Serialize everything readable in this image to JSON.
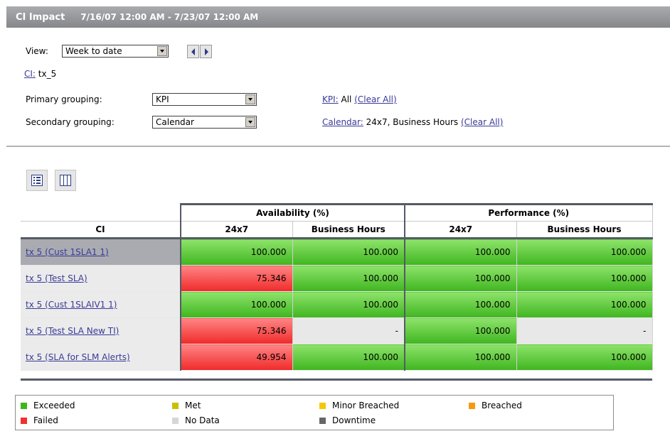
{
  "header": {
    "title": "CI Impact",
    "date_range": "7/16/07 12:00 AM - 7/23/07 12:00 AM"
  },
  "filters": {
    "view_label": "View:",
    "view_value": "Week to date",
    "ci_label": "CI:",
    "ci_value": "tx_5",
    "primary_label": "Primary grouping:",
    "primary_value": "KPI",
    "secondary_label": "Secondary grouping:",
    "secondary_value": "Calendar",
    "kpi_label": "KPI:",
    "kpi_value": "All",
    "kpi_clear": "(Clear All)",
    "calendar_label": "Calendar:",
    "calendar_value": "24x7, Business Hours",
    "calendar_clear": "(Clear All)"
  },
  "table": {
    "groups": [
      "Availability (%)",
      "Performance (%)"
    ],
    "columns": [
      "CI",
      "24x7",
      "Business Hours",
      "24x7",
      "Business Hours"
    ],
    "rows": [
      {
        "ci": "tx 5 (Cust 1SLA1 1)",
        "cells": [
          {
            "v": "100.000",
            "status": "green"
          },
          {
            "v": "100.000",
            "status": "green"
          },
          {
            "v": "100.000",
            "status": "green"
          },
          {
            "v": "100.000",
            "status": "green"
          }
        ]
      },
      {
        "ci": "tx 5 (Test SLA)",
        "cells": [
          {
            "v": "75.346",
            "status": "red"
          },
          {
            "v": "100.000",
            "status": "green"
          },
          {
            "v": "100.000",
            "status": "green"
          },
          {
            "v": "100.000",
            "status": "green"
          }
        ]
      },
      {
        "ci": "tx 5 (Cust 1SLAIV1 1)",
        "cells": [
          {
            "v": "100.000",
            "status": "green"
          },
          {
            "v": "100.000",
            "status": "green"
          },
          {
            "v": "100.000",
            "status": "green"
          },
          {
            "v": "100.000",
            "status": "green"
          }
        ]
      },
      {
        "ci": "tx 5 (Test SLA New TI)",
        "cells": [
          {
            "v": "75.346",
            "status": "red"
          },
          {
            "v": "-",
            "status": "nodata"
          },
          {
            "v": "100.000",
            "status": "green"
          },
          {
            "v": "-",
            "status": "nodata"
          }
        ]
      },
      {
        "ci": "tx 5 (SLA for SLM Alerts)",
        "cells": [
          {
            "v": "49.954",
            "status": "red"
          },
          {
            "v": "100.000",
            "status": "green"
          },
          {
            "v": "100.000",
            "status": "green"
          },
          {
            "v": "100.000",
            "status": "green"
          }
        ]
      }
    ]
  },
  "legend": [
    {
      "label": "Exceeded",
      "color": "#3cb81a"
    },
    {
      "label": "Met",
      "color": "#c8c000"
    },
    {
      "label": "Minor Breached",
      "color": "#f5c800"
    },
    {
      "label": "Breached",
      "color": "#f59a10"
    },
    {
      "label": "Failed",
      "color": "#f23030"
    },
    {
      "label": "No Data",
      "color": "#d6d6d6"
    },
    {
      "label": "Downtime",
      "color": "#666666"
    }
  ]
}
